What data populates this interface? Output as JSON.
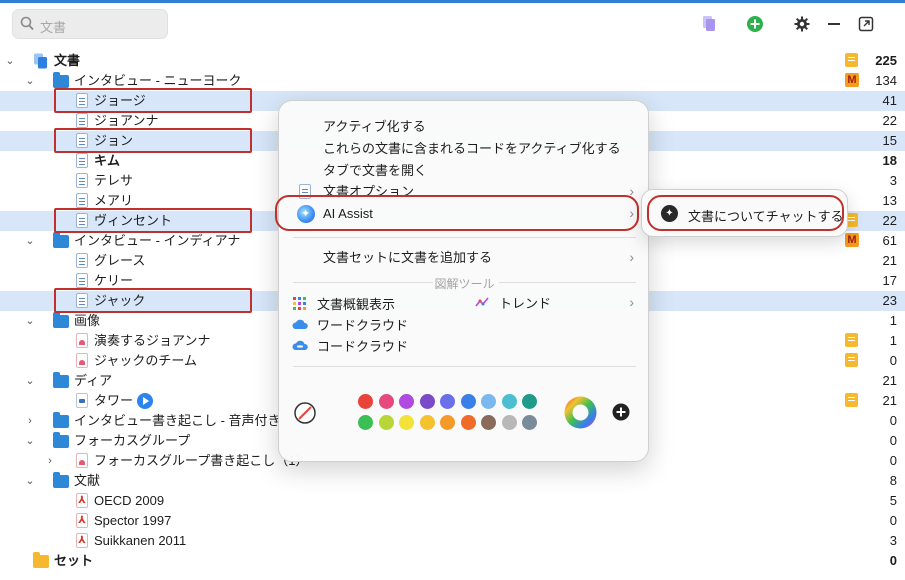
{
  "search": {
    "placeholder": "文書"
  },
  "toolbar": {
    "icons": [
      "new-document-icon",
      "add-icon",
      "gear-icon",
      "minimize-icon",
      "expand-window-icon"
    ],
    "add_color": "#2fb04c",
    "doc_icon_color": "#a995f0"
  },
  "tree": [
    {
      "label": "文書",
      "count": "225",
      "bold": true,
      "badge": "note"
    },
    {
      "label": "インタビュー - ニューヨーク",
      "count": "134",
      "badge": "memo"
    },
    {
      "label": "ジョージ",
      "count": "41",
      "selected": true
    },
    {
      "label": "ジョアンナ",
      "count": "22"
    },
    {
      "label": "ジョン",
      "count": "15",
      "selected": true
    },
    {
      "label": "キム",
      "count": "18",
      "bold": true
    },
    {
      "label": "テレサ",
      "count": "3"
    },
    {
      "label": "メアリ",
      "count": "13"
    },
    {
      "label": "ヴィンセント",
      "count": "22",
      "selected": true,
      "badge": "note"
    },
    {
      "label": "インタビュー - インディアナ",
      "count": "61",
      "badge": "memo"
    },
    {
      "label": "グレース",
      "count": "21"
    },
    {
      "label": "ケリー",
      "count": "17"
    },
    {
      "label": "ジャック",
      "count": "23",
      "selected": true
    },
    {
      "label": "画像",
      "count": "1"
    },
    {
      "label": "演奏するジョアンナ",
      "count": "1",
      "badge": "note"
    },
    {
      "label": "ジャックのチーム",
      "count": "0",
      "badge": "note"
    },
    {
      "label": "ディア",
      "count": "21"
    },
    {
      "label": "タワー",
      "count": "21",
      "badge": "note"
    },
    {
      "label": "インタビュー書き起こし - 音声付き",
      "count": "0"
    },
    {
      "label": "フォーカスグループ",
      "count": "0"
    },
    {
      "label": "フォーカスグループ書き起こし（1）",
      "count": "0"
    },
    {
      "label": "文献",
      "count": "8"
    },
    {
      "label": "OECD 2009",
      "count": "5"
    },
    {
      "label": "Spector 1997",
      "count": "0"
    },
    {
      "label": "Suikkanen 2011",
      "count": "3"
    },
    {
      "label": "セット",
      "count": "0",
      "bold": true
    }
  ],
  "menu": {
    "activate": "アクティブ化する",
    "activate_codes": "これらの文書に含まれるコードをアクティブ化する",
    "open_tab": "タブで文書を開く",
    "doc_options": "文書オプション",
    "ai_assist": "AI Assist",
    "add_to_set": "文書セットに文書を追加する",
    "visual_tools_header": "図解ツール",
    "doc_overview": "文書概観表示",
    "trend": "トレンド",
    "word_cloud": "ワードクラウド",
    "code_cloud": "コードクラウド",
    "colors_row1": [
      "#e8443a",
      "#e64a7c",
      "#b04ae0",
      "#7a4ac8",
      "#6b6fe8",
      "#3a7ee8",
      "#7ab8f0",
      "#4bbfd0",
      "#1f9b8a"
    ],
    "colors_row2": [
      "#3cbf55",
      "#b8d53a",
      "#f2e23a",
      "#f5c12e",
      "#f59a28",
      "#f06a2a",
      "#8a6a5a",
      "#b8b8b8",
      "#7a8c9a"
    ]
  },
  "submenu": {
    "chat": "文書についてチャットする"
  }
}
